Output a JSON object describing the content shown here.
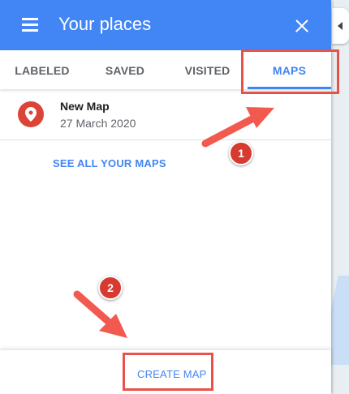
{
  "header": {
    "title": "Your places"
  },
  "tabs": [
    {
      "label": "LABELED",
      "active": false
    },
    {
      "label": "SAVED",
      "active": false
    },
    {
      "label": "VISITED",
      "active": false
    },
    {
      "label": "MAPS",
      "active": true
    }
  ],
  "maps_list": [
    {
      "name": "New Map",
      "date": "27 March 2020",
      "icon": "map-pin-icon"
    }
  ],
  "see_all_label": "SEE ALL YOUR MAPS",
  "create_map_label": "CREATE MAP",
  "annotations": {
    "step1": "1",
    "step2": "2"
  },
  "colors": {
    "header": "#4285f4",
    "accent": "#4285f4",
    "pin": "#db4437",
    "annotation": "#e8524a"
  }
}
